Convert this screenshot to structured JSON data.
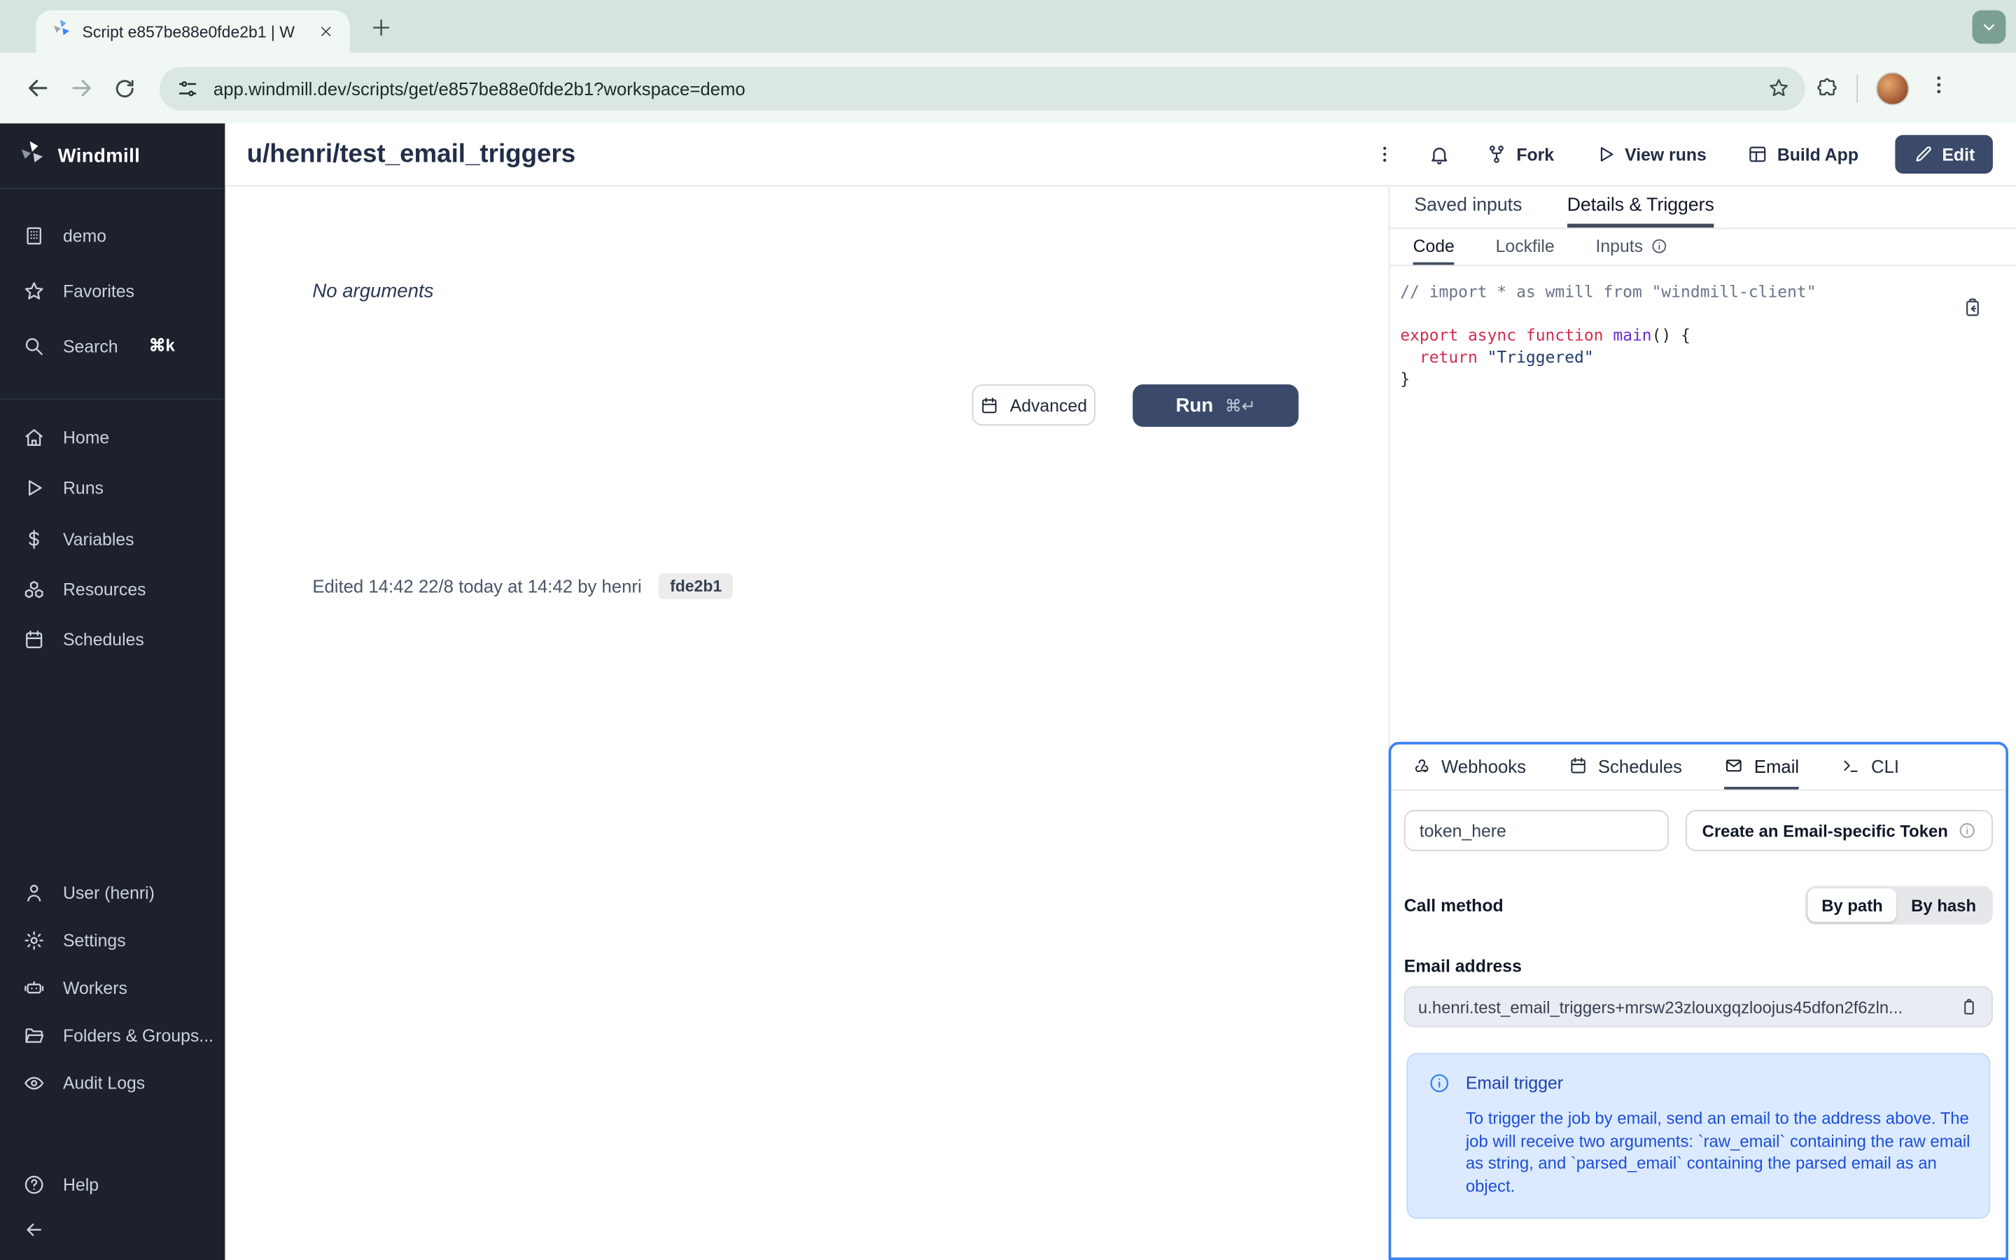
{
  "browser": {
    "tab_title": "Script e857be88e0fde2b1 | W",
    "url": "app.windmill.dev/scripts/get/e857be88e0fde2b1?workspace=demo"
  },
  "sidebar": {
    "brand": "Windmill",
    "workspace": "demo",
    "favorites": "Favorites",
    "search": "Search",
    "search_shortcut": "⌘k",
    "home": "Home",
    "runs": "Runs",
    "variables": "Variables",
    "resources": "Resources",
    "schedules": "Schedules",
    "user": "User (henri)",
    "settings": "Settings",
    "workers": "Workers",
    "folders": "Folders & Groups...",
    "audit": "Audit Logs",
    "help": "Help"
  },
  "header": {
    "title": "u/henri/test_email_triggers",
    "fork": "Fork",
    "view_runs": "View runs",
    "build_app": "Build App",
    "edit": "Edit"
  },
  "main": {
    "no_arguments": "No arguments",
    "advanced": "Advanced",
    "run": "Run",
    "run_shortcut": "⌘↵",
    "edited": "Edited 14:42 22/8 today at 14:42 by henri",
    "version": "fde2b1"
  },
  "details": {
    "tab_saved": "Saved inputs",
    "tab_details": "Details & Triggers",
    "subtab_code": "Code",
    "subtab_lockfile": "Lockfile",
    "subtab_inputs": "Inputs",
    "code": {
      "comment": "// import * as wmill from \"windmill-client\"",
      "kw_export": "export async function ",
      "fn": "main",
      "sig": "() {",
      "indent": "  ",
      "kw_return": "return ",
      "str": "\"Triggered\"",
      "brace": "}"
    }
  },
  "triggers": {
    "tab_webhooks": "Webhooks",
    "tab_schedules": "Schedules",
    "tab_email": "Email",
    "tab_cli": "CLI",
    "token_value": "token_here",
    "create_token": "Create an Email-specific Token",
    "call_method": "Call method",
    "by_path": "By path",
    "by_hash": "By hash",
    "email_address": "Email address",
    "email_value": "u.henri.test_email_triggers+mrsw23zlouxgqzloojus45dfon2f6zln...",
    "info_title": "Email trigger",
    "info_body": "To trigger the job by email, send an email to the address above. The job will receive two arguments: `raw_email` containing the raw email as string, and `parsed_email` containing the parsed email as an object."
  },
  "colors": {
    "accent_blue": "#3b82f6",
    "primary_navy": "#3b4a6a",
    "sidebar_bg": "#1c212c",
    "chrome_bg": "#d5e5dd",
    "info_bg": "#dbeafe",
    "info_text": "#1d4ed8"
  }
}
